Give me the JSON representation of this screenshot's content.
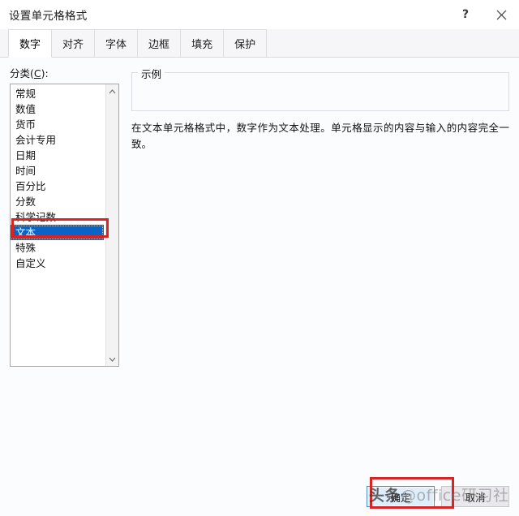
{
  "window": {
    "title": "设置单元格格式",
    "help_icon": "question-mark-icon",
    "close_icon": "close-icon"
  },
  "tabs": [
    {
      "label": "数字",
      "active": true
    },
    {
      "label": "对齐",
      "active": false
    },
    {
      "label": "字体",
      "active": false
    },
    {
      "label": "边框",
      "active": false
    },
    {
      "label": "填充",
      "active": false
    },
    {
      "label": "保护",
      "active": false
    }
  ],
  "category": {
    "label_prefix": "分类(",
    "label_accel": "C",
    "label_suffix": "):",
    "items": [
      {
        "label": "常规",
        "selected": false
      },
      {
        "label": "数值",
        "selected": false
      },
      {
        "label": "货币",
        "selected": false
      },
      {
        "label": "会计专用",
        "selected": false
      },
      {
        "label": "日期",
        "selected": false
      },
      {
        "label": "时间",
        "selected": false
      },
      {
        "label": "百分比",
        "selected": false
      },
      {
        "label": "分数",
        "selected": false
      },
      {
        "label": "科学记数",
        "selected": false
      },
      {
        "label": "文本",
        "selected": true
      },
      {
        "label": "特殊",
        "selected": false
      },
      {
        "label": "自定义",
        "selected": false
      }
    ],
    "scroll_up_icon": "chevron-up-icon",
    "scroll_down_icon": "chevron-down-icon",
    "selection_highlight_color": "#0a64c8"
  },
  "sample": {
    "group_title": "示例",
    "value": ""
  },
  "description": "在文本单元格格式中，数字作为文本处理。单元格显示的内容与输入的内容完全一致。",
  "footer": {
    "ok_label": "确定",
    "cancel_label": "取消"
  },
  "annotations": {
    "color": "#d82424",
    "items": [
      {
        "name": "text-category-highlight"
      },
      {
        "name": "ok-button-highlight"
      }
    ]
  },
  "watermark": {
    "prefix": "头条",
    "middle": "@office",
    "suffix": "研习社"
  }
}
